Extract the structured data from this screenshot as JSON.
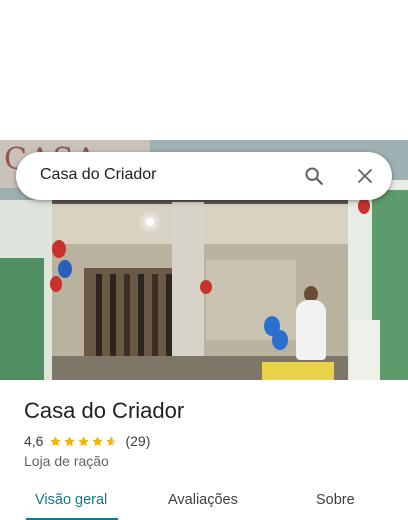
{
  "search": {
    "query": "Casa do Criador"
  },
  "place": {
    "name": "Casa do Criador",
    "rating": "4,6",
    "stars": 4.6,
    "review_count": "(29)",
    "category": "Loja de ração"
  },
  "tabs": [
    {
      "label": "Visão geral",
      "active": true
    },
    {
      "label": "Avaliações",
      "active": false
    },
    {
      "label": "Sobre",
      "active": false
    }
  ],
  "colors": {
    "accent": "#0b7a8a",
    "star": "#f4b400"
  },
  "icons": {
    "search": "search-icon",
    "close": "close-icon",
    "star": "star-icon"
  }
}
